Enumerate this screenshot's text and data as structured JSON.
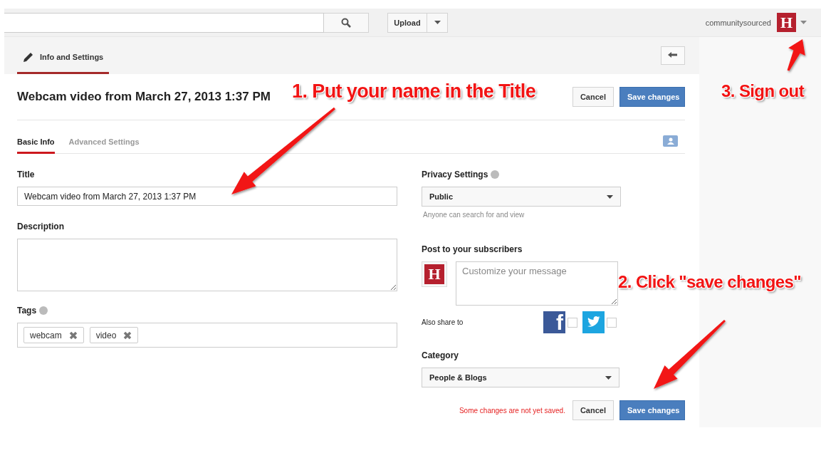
{
  "header": {
    "upload_button": "Upload",
    "username": "communitysourced",
    "avatar_letter": "H"
  },
  "page_tabs": [
    {
      "label": "Info and Settings",
      "selected": true
    }
  ],
  "video_title": "Webcam video from March 27, 2013 1:37 PM",
  "top_actions": [
    "Cancel",
    "Save changes"
  ],
  "subtabs": [
    {
      "label": "Basic Info",
      "selected": true
    },
    {
      "label": "Advanced Settings",
      "selected": false
    }
  ],
  "title_field": {
    "label": "Title",
    "value": "Webcam video from March 27, 2013 1:37 PM"
  },
  "description_field": {
    "label": "Description"
  },
  "tags_field": {
    "label": "Tags",
    "tags": [
      "webcam",
      "video"
    ]
  },
  "privacy": {
    "label": "Privacy Settings",
    "value": "Public",
    "hint": "Anyone can search for and view"
  },
  "post": {
    "label": "Post to your subscribers",
    "avatar_letter": "H",
    "placeholder": "Customize your message",
    "share_label": "Also share to",
    "share_targets": [
      {
        "kind": "facebook",
        "glyph": "f",
        "checked": false
      },
      {
        "kind": "twitter",
        "checked": false
      }
    ]
  },
  "category": {
    "label": "Category",
    "value": "People & Blogs"
  },
  "footer": {
    "status": "Some changes are not yet saved.",
    "buttons": [
      "Cancel",
      "Save changes"
    ]
  },
  "annotations": [
    {
      "text": "1. Put your name in the Title"
    },
    {
      "text": "3. Sign out"
    },
    {
      "text": "2. Click \"save changes\""
    }
  ]
}
